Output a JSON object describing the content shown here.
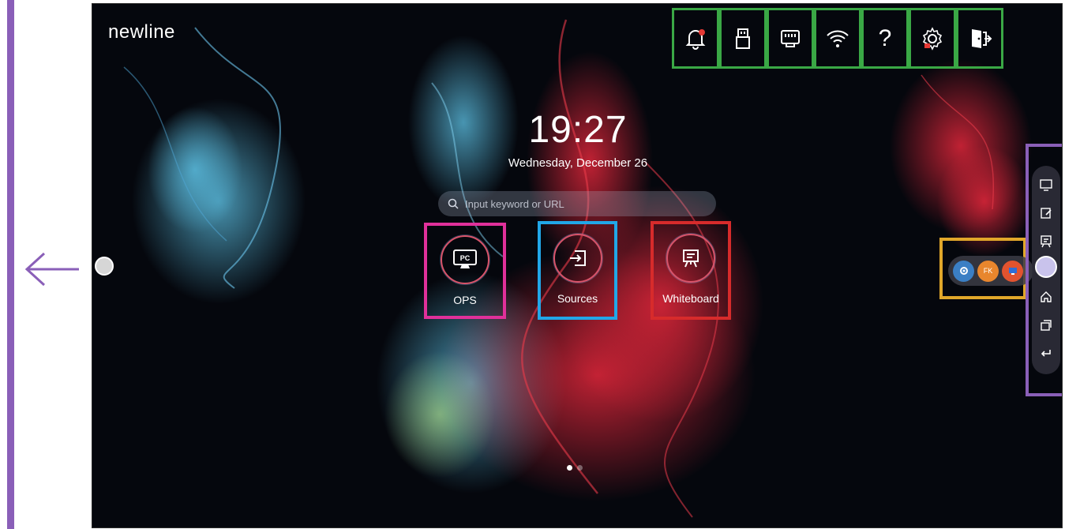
{
  "brand": "newline",
  "topbar": {
    "buttons": [
      {
        "name": "notification-icon"
      },
      {
        "name": "usb-icon"
      },
      {
        "name": "network-icon"
      },
      {
        "name": "wifi-icon"
      },
      {
        "name": "help-icon",
        "label": "?"
      },
      {
        "name": "settings-icon"
      },
      {
        "name": "exit-icon"
      }
    ],
    "highlight_color": "#3aa845"
  },
  "clock": {
    "time": "19:27",
    "date": "Wednesday, December 26"
  },
  "search": {
    "placeholder": "Input keyword or URL"
  },
  "apps": [
    {
      "label": "OPS",
      "icon_text": "PC",
      "highlight_color": "#e0309a"
    },
    {
      "label": "Sources",
      "highlight_color": "#21a7e8"
    },
    {
      "label": "Whiteboard",
      "highlight_color": "#d72b2b"
    }
  ],
  "pager": {
    "pages": 2,
    "current": 1
  },
  "dock": {
    "apps": [
      {
        "name": "settings-app-icon"
      },
      {
        "name": "fk-app-icon",
        "text": "FK"
      },
      {
        "name": "screen-app-icon"
      }
    ],
    "highlight_color": "#e1a72a"
  },
  "sidebar": {
    "items": [
      "ops-icon",
      "annotate-icon",
      "whiteboard-icon",
      "home-icon",
      "windows-icon",
      "back-icon"
    ],
    "highlight_color": "#8a5fb8"
  }
}
